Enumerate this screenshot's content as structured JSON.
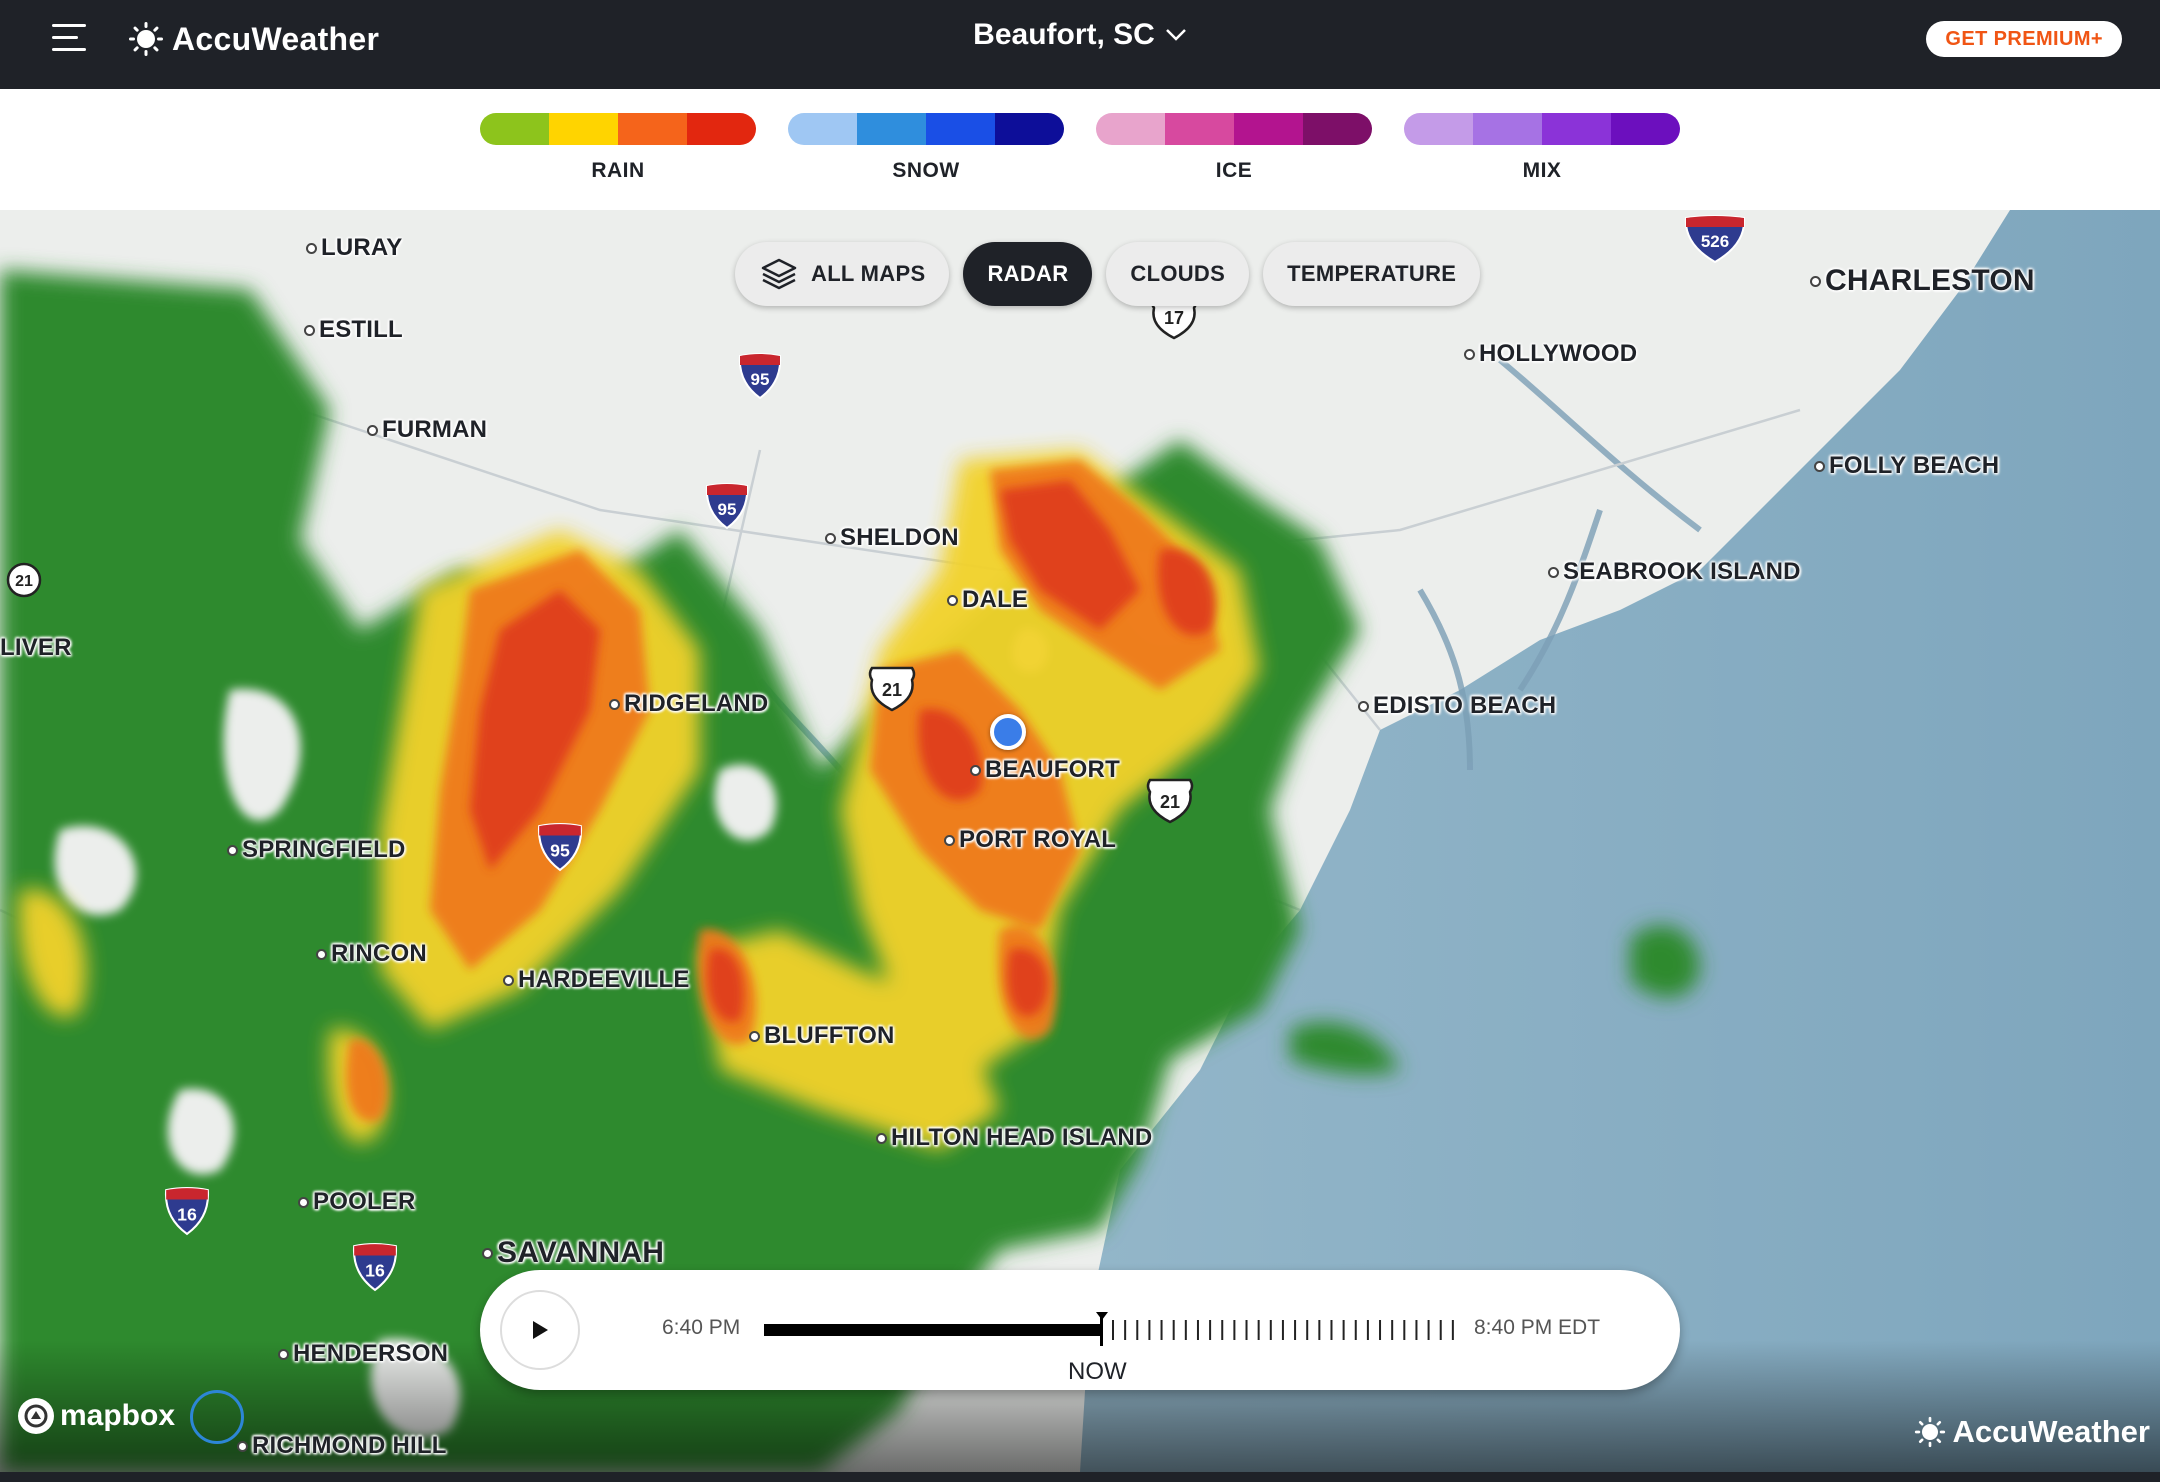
{
  "header": {
    "brand": "AccuWeather",
    "location": "Beaufort, SC",
    "premium_label": "GET PREMIUM+"
  },
  "legend": [
    {
      "label": "RAIN",
      "colors": [
        "#8dc41c",
        "#ffd400",
        "#f5641b",
        "#e2270f"
      ]
    },
    {
      "label": "SNOW",
      "colors": [
        "#9fc7f3",
        "#2f8edd",
        "#1a4fe6",
        "#0d0e99"
      ]
    },
    {
      "label": "ICE",
      "colors": [
        "#e8a4cc",
        "#d7499f",
        "#b3148f",
        "#7d0f68"
      ]
    },
    {
      "label": "MIX",
      "colors": [
        "#c49be8",
        "#a672e4",
        "#8b33d8",
        "#6c0fbe"
      ]
    }
  ],
  "map_tabs": [
    {
      "label": "ALL MAPS",
      "icon": "layers-icon",
      "active": false
    },
    {
      "label": "RADAR",
      "active": true
    },
    {
      "label": "CLOUDS",
      "active": false
    },
    {
      "label": "TEMPERATURE",
      "active": false
    }
  ],
  "places": {
    "luray": "LURAY",
    "estill": "ESTILL",
    "furman": "FURMAN",
    "oliver": "LIVER",
    "sheldon": "SHELDON",
    "dale": "DALE",
    "ridgeland": "RIDGELAND",
    "beaufort": "BEAUFORT",
    "port_royal": "PORT ROYAL",
    "springfield": "SPRINGFIELD",
    "rincon": "RINCON",
    "hardeeville": "HARDEEVILLE",
    "bluffton": "BLUFFTON",
    "hilton_head": "HILTON HEAD ISLAND",
    "pooler": "POOLER",
    "savannah": "SAVANNAH",
    "henderson": "HENDERSON",
    "richmond_hill": "RICHMOND HILL",
    "charleston": "CHARLESTON",
    "hollywood": "HOLLYWOOD",
    "folly_beach": "FOLLY BEACH",
    "seabrook": "SEABROOK ISLAND",
    "edisto": "EDISTO BEACH"
  },
  "routes": {
    "i95": "95",
    "i16": "16",
    "i526": "526",
    "us21": "21",
    "us17": "17"
  },
  "timeline": {
    "start": "6:40 PM",
    "end": "8:40 PM EDT",
    "now_label": "NOW",
    "progress": 0.49
  },
  "attribution": {
    "mapbox": "mapbox",
    "watermark": "AccuWeather"
  }
}
